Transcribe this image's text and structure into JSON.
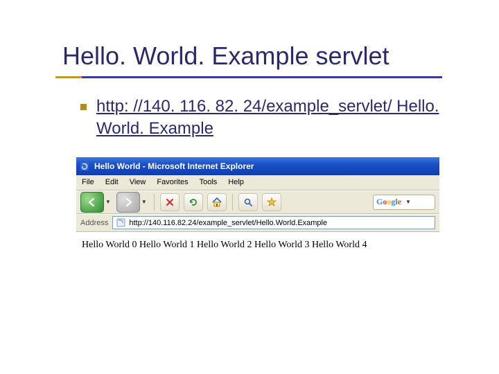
{
  "slide": {
    "title": "Hello. World. Example servlet",
    "bullet_link_text": "http: //140. 116. 82. 24/example_servlet/ Hello. World. Example"
  },
  "ie": {
    "window_title": "Hello World - Microsoft Internet Explorer",
    "menu": {
      "file": "File",
      "edit": "Edit",
      "view": "View",
      "favorites": "Favorites",
      "tools": "Tools",
      "help": "Help"
    },
    "toolbar": {
      "back_icon": "arrow-left",
      "forward_icon": "arrow-right",
      "stop_icon": "x",
      "refresh_icon": "refresh",
      "home_icon": "home",
      "search_icon": "search",
      "favorites_icon": "star"
    },
    "google_placeholder": "Google",
    "address_label": "Address",
    "address_value": "http://140.116.82.24/example_servlet/Hello.World.Example",
    "page_body": "Hello World 0 Hello World 1 Hello World 2 Hello World 3 Hello World 4"
  },
  "colors": {
    "title_color": "#2a2a6a",
    "accent": "#c2992a",
    "ie_titlebar_start": "#3b77e0",
    "ie_titlebar_end": "#0f3db0",
    "ie_chrome": "#ece9d8"
  }
}
